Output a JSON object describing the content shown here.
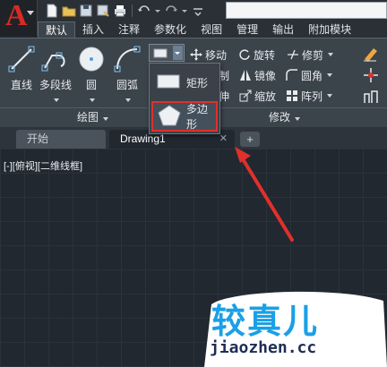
{
  "app": {
    "logo": "A"
  },
  "ribbon_tabs": [
    "默认",
    "插入",
    "注释",
    "参数化",
    "视图",
    "管理",
    "输出",
    "附加模块"
  ],
  "draw_panel": {
    "title": "绘图",
    "buttons": [
      {
        "label": "直线",
        "icon": "line-icon"
      },
      {
        "label": "多段线",
        "icon": "polyline-icon"
      },
      {
        "label": "圆",
        "icon": "circle-icon"
      },
      {
        "label": "圆弧",
        "icon": "arc-icon"
      }
    ]
  },
  "modify_panel": {
    "title": "修改",
    "rows": [
      [
        "移动",
        "旋转",
        "修剪"
      ],
      [
        "制",
        "镜像",
        "圆角"
      ],
      [
        "伸",
        "缩放",
        "阵列"
      ]
    ]
  },
  "dropdown": {
    "items": [
      {
        "label": "矩形",
        "icon": "rectangle-icon"
      },
      {
        "label": "多边形",
        "icon": "polygon-icon"
      }
    ]
  },
  "file_tabs": {
    "start": "开始",
    "active": "Drawing1",
    "close": "✕",
    "add": "+"
  },
  "viewport": {
    "label": "[-][俯视][二维线框]"
  },
  "watermark": {
    "chinese": "较真儿",
    "url": "jiaozhen.cc"
  },
  "colors": {
    "accent_red": "#e0302c",
    "canvas": "#212830",
    "watermark_blue": "#1aa0e6"
  }
}
